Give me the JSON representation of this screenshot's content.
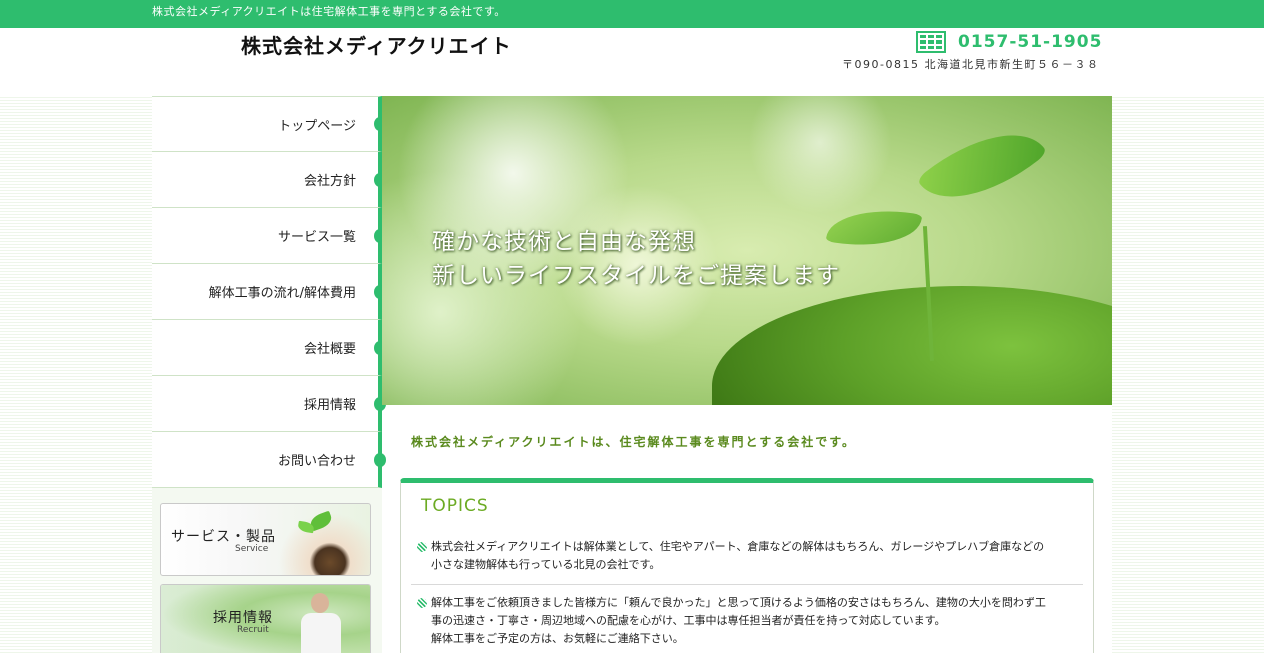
{
  "topbar": {
    "text": "株式会社メディアクリエイトは住宅解体工事を専門とする会社です。"
  },
  "header": {
    "logo": "株式会社メディアクリエイト",
    "phone": "0157-51-1905",
    "address": "〒090-0815 北海道北見市新生町５６－３８",
    "phone_icon": "building-phone-icon"
  },
  "nav": {
    "items": [
      {
        "label": "トップページ"
      },
      {
        "label": "会社方針"
      },
      {
        "label": "サービス一覧"
      },
      {
        "label": "解体工事の流れ/解体費用"
      },
      {
        "label": "会社概要"
      },
      {
        "label": "採用情報"
      },
      {
        "label": "お問い合わせ"
      }
    ]
  },
  "banners": [
    {
      "title": "サービス・製品",
      "sub": "Service"
    },
    {
      "title": "採用情報",
      "sub": "Recruit"
    }
  ],
  "hero": {
    "line1": "確かな技術と自由な発想",
    "line2": "新しいライフスタイルをご提案します"
  },
  "intro": "株式会社メディアクリエイトは、住宅解体工事を専門とする会社です。",
  "topics": {
    "title": "TOPICS",
    "items": [
      {
        "line1": "株式会社メディアクリエイトは解体業として、住宅やアパート、倉庫などの解体はもちろん、ガレージやプレハブ倉庫などの",
        "line2": "小さな建物解体も行っている北見の会社です。"
      },
      {
        "line1": "解体工事をご依頼頂きました皆様方に「頼んで良かった」と思って頂けるよう価格の安さはもちろん、建物の大小を問わず工",
        "line2": "事の迅速さ・丁寧さ・周辺地域への配慮を心がけ、工事中は専任担当者が責任を持って対応しています。",
        "line3": "解体工事をご予定の方は、お気軽にご連絡下さい。"
      }
    ]
  },
  "colors": {
    "accent": "#2ebd6e",
    "intro": "#5a8a1e",
    "topics_title": "#6cab24"
  }
}
